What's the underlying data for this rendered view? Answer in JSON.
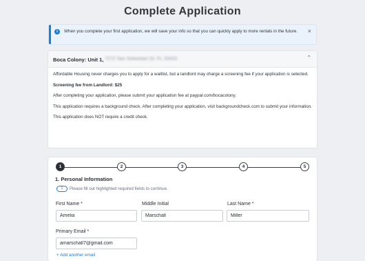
{
  "page": {
    "title": "Complete Application"
  },
  "alert": {
    "icon": "info-icon",
    "message": "When you complete your first application, we will save your info so that you can quickly apply to more rentals in the future.",
    "close_label": "×"
  },
  "property": {
    "title": "Boca Colony: Unit 1,",
    "address": "7272 San Sebastian Dr, FL 33433",
    "toggle_icon": "chevron-up-icon",
    "toggle_glyph": "⌃",
    "body": {
      "p1": "Affordable Housing never charges you to apply for a waitlist, but a landlord may charge a screening fee if your application is selected.",
      "p2": "Screening fee from Landlord: $25",
      "p3": "After completing your application, please submit your application fee at paypal.com/bocacolony.",
      "p4": "This application requires a background check. After completing your application, visit backgroundcheck.com to submit your information.",
      "p5": "This application does NOT require a credit check."
    }
  },
  "stepper": {
    "steps": [
      "1",
      "2",
      "3",
      "4",
      "5"
    ],
    "active": 1
  },
  "form": {
    "section_title": "1. Personal Information",
    "required_note": "Please fill out highlighted required fields to continue.",
    "required_pill": "1",
    "first_name": {
      "label": "First Name *",
      "value": "Amelia"
    },
    "middle_initial": {
      "label": "Middle Initial",
      "value": "Marschall"
    },
    "last_name": {
      "label": "Last Name *",
      "value": "Miller"
    },
    "primary_email": {
      "label": "Primary Email *",
      "value": "amarschall7@gmail.com"
    },
    "add_email_label": "+ Add another email"
  },
  "colors": {
    "accent": "#1c7ed6",
    "background": "#eeeff2",
    "text": "#2a2d33"
  }
}
